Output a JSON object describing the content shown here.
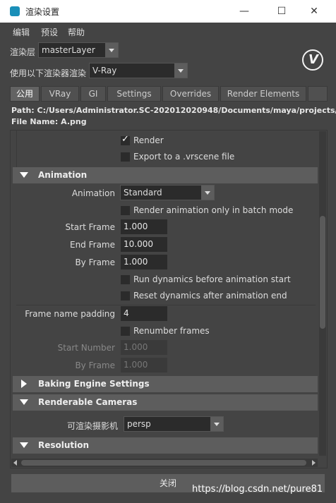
{
  "window": {
    "title": "渲染设置",
    "minimize_glyph": "—",
    "maximize_glyph": "☐",
    "close_glyph": "✕"
  },
  "menu": {
    "items": [
      "编辑",
      "预设",
      "帮助"
    ]
  },
  "render_layer": {
    "label": "渲染层",
    "value": "masterLayer"
  },
  "renderer": {
    "label": "使用以下渲染器渲染",
    "value": "V-Ray"
  },
  "logo": {
    "icon": "vray-logo-icon",
    "glyph": "V"
  },
  "tabs": [
    "公用",
    "VRay",
    "GI",
    "Settings",
    "Overrides",
    "Render Elements"
  ],
  "active_tab": "公用",
  "path": {
    "path_text": "Path: C:/Users/Administrator.SC-202012020948/Documents/maya/projects/defau",
    "file_text": "File Name: A.png"
  },
  "top_checks": [
    {
      "label": "Render",
      "checked": true
    },
    {
      "label": "Export to a .vrscene file",
      "checked": false
    }
  ],
  "animation": {
    "header": "Animation",
    "anim_label": "Animation",
    "anim_value": "Standard",
    "batch_only": "Render animation only in batch mode",
    "start_label": "Start Frame",
    "start_value": "1.000",
    "end_label": "End Frame",
    "end_value": "10.000",
    "by_label": "By Frame",
    "by_value": "1.000",
    "run_dynamics": "Run dynamics before animation start",
    "reset_dynamics": "Reset dynamics after animation end",
    "padding_label": "Frame name padding",
    "padding_value": "4",
    "renumber": "Renumber frames",
    "start_number_label": "Start Number",
    "start_number_value": "1.000",
    "by_frame2_label": "By Frame",
    "by_frame2_value": "1.000"
  },
  "baking": {
    "header": "Baking Engine Settings"
  },
  "cameras": {
    "header": "Renderable Cameras",
    "label": "可渲染摄影机",
    "value": "persp"
  },
  "resolution": {
    "header": "Resolution"
  },
  "footer": {
    "close_label": "关闭",
    "watermark": "https://blog.csdn.net/pure81"
  }
}
